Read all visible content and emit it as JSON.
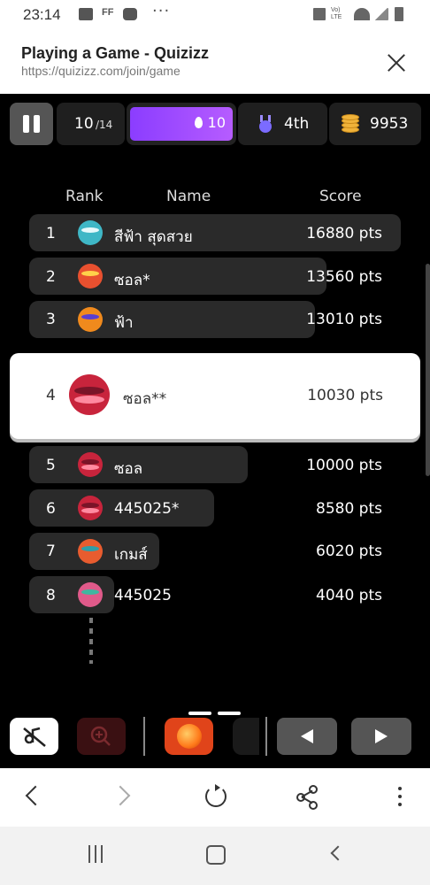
{
  "status_bar": {
    "time": "23:14",
    "ff_label": "FF",
    "more": "···",
    "volte": "Vo) LTE"
  },
  "browser": {
    "page_title": "Playing a Game - Quizizz",
    "url": "https://quizizz.com/join/game"
  },
  "game": {
    "question_current": "10",
    "question_total": "/14",
    "streak": "10",
    "rank": "4th",
    "coins": "9953",
    "leaderboard_headers": {
      "rank": "Rank",
      "name": "Name",
      "score": "Score"
    },
    "rows": [
      {
        "rank": "1",
        "name": "สีฟ้า สุดสวย",
        "score": "16880 pts",
        "avatar_color": "#3fb7c6"
      },
      {
        "rank": "2",
        "name": "ซอล*",
        "score": "13560 pts",
        "avatar_color": "#e8502f"
      },
      {
        "rank": "3",
        "name": "ฟ้า",
        "score": "13010 pts",
        "avatar_color": "#f08a1d"
      },
      {
        "rank": "4",
        "name": "ซอล**",
        "score": "10030 pts",
        "avatar_color": "#c8243c",
        "highlighted": true
      },
      {
        "rank": "5",
        "name": "ซอล",
        "score": "10000 pts",
        "avatar_color": "#c8243c"
      },
      {
        "rank": "6",
        "name": "445025*",
        "score": "8580 pts",
        "avatar_color": "#c8243c"
      },
      {
        "rank": "7",
        "name": "เกมส์",
        "score": "6020 pts",
        "avatar_color": "#e85c2f"
      },
      {
        "rank": "8",
        "name": "445025",
        "score": "4040 pts",
        "avatar_color": "#e05a8a"
      }
    ]
  },
  "colors": {
    "streak_purple": "#a24dff",
    "coin_gold": "#f0b33a",
    "medal_purple": "#7b6bff",
    "powerup_orange": "#e0441a"
  },
  "icons": {
    "pause": "pause-icon",
    "flame": "flame-icon",
    "medal": "medal-icon",
    "coins": "coin-stack-icon",
    "music_off": "music-off-icon",
    "zoom": "zoom-in-icon",
    "powerup": "powerup-icon",
    "prev": "previous-icon",
    "next": "next-icon"
  }
}
